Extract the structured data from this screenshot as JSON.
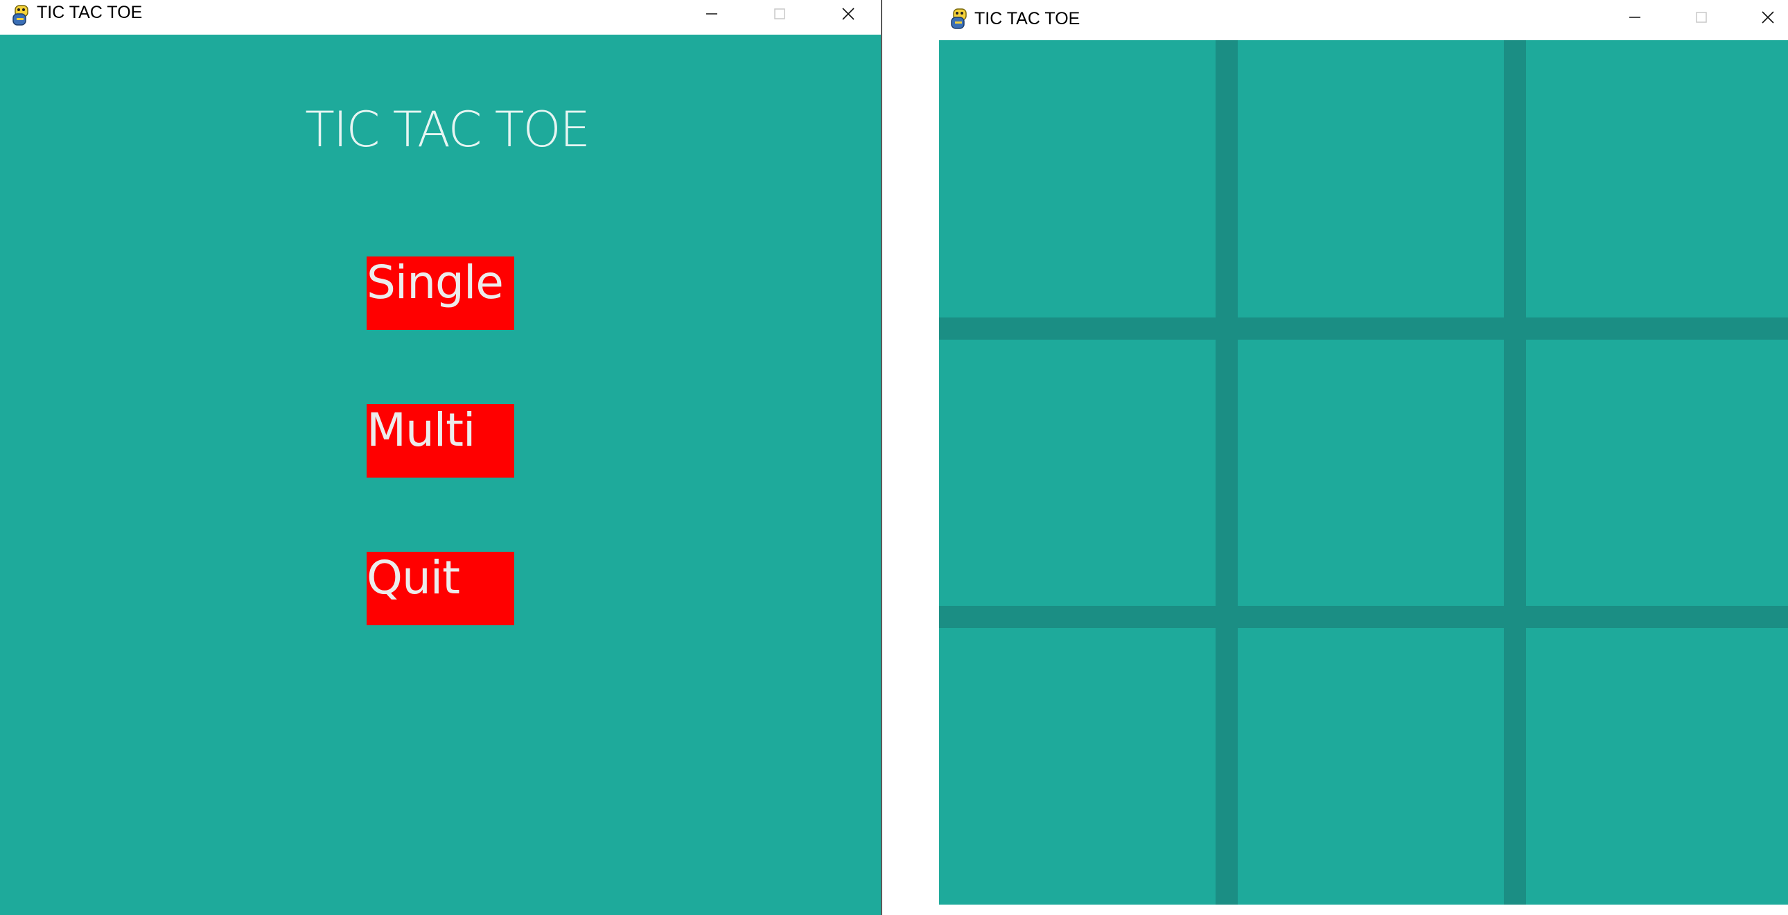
{
  "menu_window": {
    "title": "TIC TAC TOE",
    "heading": "TIC TAC TOE",
    "buttons": [
      {
        "label": "Single"
      },
      {
        "label": "Multi"
      },
      {
        "label": "Quit"
      }
    ]
  },
  "game_window": {
    "title": "TIC TAC TOE",
    "board": {
      "rows": 3,
      "cols": 3,
      "cells": [
        "",
        "",
        "",
        "",
        "",
        "",
        "",
        "",
        ""
      ]
    }
  },
  "colors": {
    "background": "#1eaa9b",
    "grid_line": "#1b8e84",
    "button": "#ff0000",
    "button_text": "#ececec",
    "heading_text": "#e6f5f2"
  },
  "icons": {
    "app": "python-snake-icon",
    "minimize": "minimize-icon",
    "maximize": "maximize-icon",
    "close": "close-icon"
  }
}
